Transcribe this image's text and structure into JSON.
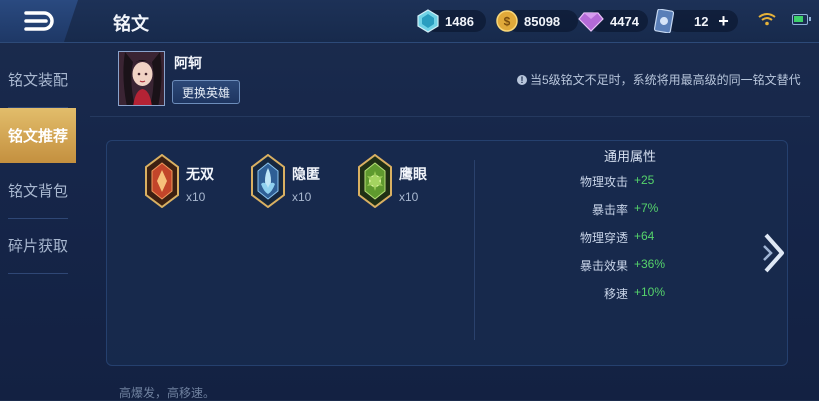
{
  "header": {
    "title": "铭文"
  },
  "resources": [
    {
      "icon": "crystal-icon",
      "value": "1486"
    },
    {
      "icon": "gold-coin-icon",
      "value": "85098"
    },
    {
      "icon": "diamond-icon",
      "value": "4474"
    },
    {
      "icon": "ticket-card-icon",
      "value": "12"
    }
  ],
  "sidebar": {
    "items": [
      {
        "label": "铭文装配",
        "active": false
      },
      {
        "label": "铭文推荐",
        "active": true
      },
      {
        "label": "铭文背包",
        "active": false
      },
      {
        "label": "碎片获取",
        "active": false
      }
    ]
  },
  "hero": {
    "name": "阿轲",
    "change_label": "更换英雄"
  },
  "hint": "当5级铭文不足时，系统将用最高级的同一铭文替代",
  "runes": [
    {
      "name": "无双",
      "count": "x10",
      "color": "#c2452a"
    },
    {
      "name": "隐匿",
      "count": "x10",
      "color": "#4f86c9"
    },
    {
      "name": "鹰眼",
      "count": "x10",
      "color": "#6ea834"
    }
  ],
  "stats": {
    "title": "通用属性",
    "rows": [
      {
        "name": "物理攻击",
        "value": "+25"
      },
      {
        "name": "暴击率",
        "value": "+7%"
      },
      {
        "name": "物理穿透",
        "value": "+64"
      },
      {
        "name": "暴击效果",
        "value": "+36%"
      },
      {
        "name": "移速",
        "value": "+10%"
      }
    ]
  },
  "footer": "高爆发，高移速。",
  "colors": {
    "accent_gold": "#d9b062",
    "stat_green": "#55d36b"
  }
}
